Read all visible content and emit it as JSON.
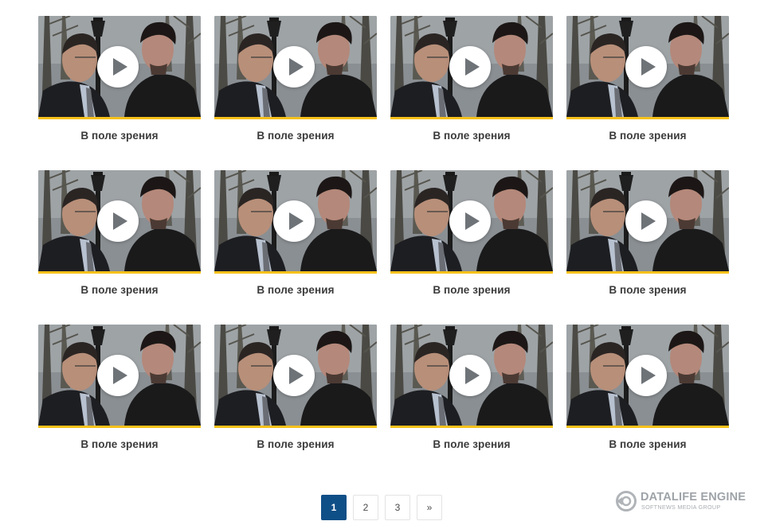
{
  "videos": [
    {
      "title": "В поле зрения"
    },
    {
      "title": "В поле зрения"
    },
    {
      "title": "В поле зрения"
    },
    {
      "title": "В поле зрения"
    },
    {
      "title": "В поле зрения"
    },
    {
      "title": "В поле зрения"
    },
    {
      "title": "В поле зрения"
    },
    {
      "title": "В поле зрения"
    },
    {
      "title": "В поле зрения"
    },
    {
      "title": "В поле зрения"
    },
    {
      "title": "В поле зрения"
    },
    {
      "title": "В поле зрения"
    }
  ],
  "pagination": {
    "pages": [
      "1",
      "2",
      "3"
    ],
    "current": "1",
    "next_label": "»"
  },
  "branding": {
    "name": "DATALIFE ENGINE",
    "subtitle": "SOFTNEWS MEDIA GROUP"
  },
  "colors": {
    "accent_bar": "#f6c11a",
    "active_page": "#0f4f87",
    "title_text": "#3b3b3b"
  },
  "icons": {
    "thumbnail_overlay": "play-icon",
    "brand": "datalife-logo-icon"
  }
}
